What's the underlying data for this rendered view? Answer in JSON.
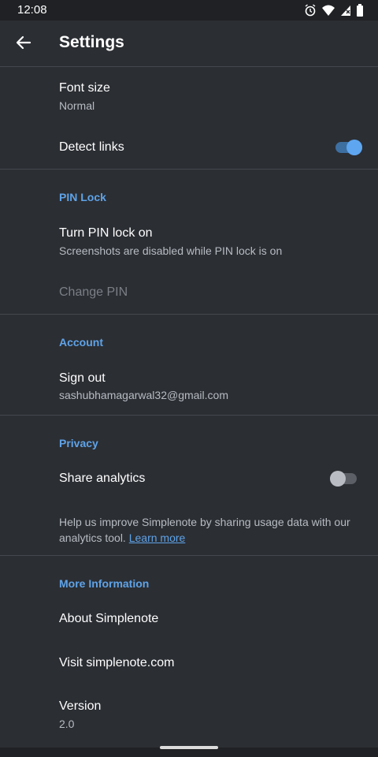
{
  "status_bar": {
    "time": "12:08"
  },
  "app_bar": {
    "title": "Settings"
  },
  "settings": {
    "font_size": {
      "title": "Font size",
      "value": "Normal"
    },
    "detect_links": {
      "title": "Detect links",
      "enabled": true
    },
    "pin_section": "PIN Lock",
    "turn_pin": {
      "title": "Turn PIN lock on",
      "sub": "Screenshots are disabled while PIN lock is on"
    },
    "change_pin": {
      "title": "Change PIN"
    },
    "account_section": "Account",
    "sign_out": {
      "title": "Sign out",
      "email": "sashubhamagarwal32@gmail.com"
    },
    "privacy_section": "Privacy",
    "share_analytics": {
      "title": "Share analytics",
      "enabled": false
    },
    "help_text": "Help us improve Simplenote by sharing usage data with our analytics tool. ",
    "learn_more": "Learn more",
    "more_info_section": "More Information",
    "about": {
      "title": "About Simplenote"
    },
    "visit": {
      "title": "Visit simplenote.com"
    },
    "version": {
      "title": "Version",
      "value": "2.0"
    }
  },
  "colors": {
    "background": "#2b2e33",
    "accent": "#5fa3e8",
    "subtitle": "#b7bcc3",
    "disabled": "#7b7f86"
  }
}
